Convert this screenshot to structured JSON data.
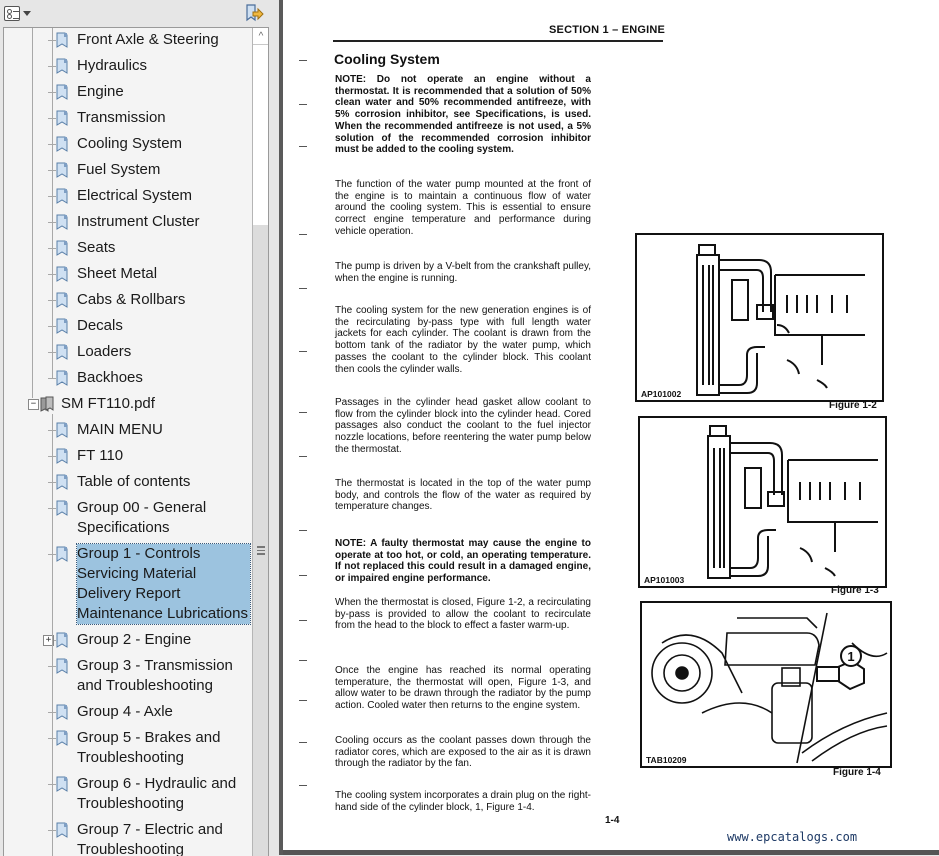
{
  "panel": {
    "toolbar": {
      "options_icon": "bookmark-options-icon",
      "expand_icon": "expand-current-bookmark-icon"
    },
    "bookmarks_top": [
      "Front Axle & Steering",
      "Hydraulics",
      "Engine",
      "Transmission",
      "Cooling System",
      "Fuel System",
      "Electrical System",
      "Instrument Cluster",
      "Seats",
      "Sheet Metal",
      "Cabs & Rollbars",
      "Decals",
      "Loaders",
      "Backhoes"
    ],
    "file_node": {
      "label": "SM FT110.pdf",
      "expander": "−"
    },
    "file_children": [
      {
        "lines": [
          "MAIN MENU"
        ]
      },
      {
        "lines": [
          "FT 110"
        ]
      },
      {
        "lines": [
          "Table of contents"
        ]
      },
      {
        "lines": [
          "Group 00 - General",
          "Specifications"
        ]
      },
      {
        "lines": [
          "Group 1 - Controls",
          "Servicing Material",
          "Delivery Report",
          "Maintenance Lubrications"
        ],
        "selected": true
      },
      {
        "lines": [
          "Group 2 - Engine"
        ],
        "expander": "+"
      },
      {
        "lines": [
          "Group 3 - Transmission",
          "and Troubleshooting"
        ]
      },
      {
        "lines": [
          "Group 4 - Axle"
        ]
      },
      {
        "lines": [
          "Group 5 - Brakes and",
          "Troubleshooting"
        ]
      },
      {
        "lines": [
          "Group 6 - Hydraulic and",
          "Troubleshooting"
        ]
      },
      {
        "lines": [
          "Group 7 - Electric and",
          "Troubleshooting"
        ]
      }
    ],
    "scrollbar": {
      "up_arrow": "^"
    }
  },
  "document": {
    "section_header": "SECTION 1 – ENGINE",
    "title": "Cooling System",
    "paragraphs": [
      {
        "text": "NOTE: Do not operate an engine without a thermostat. It is recommended that a solution of 50% clean water and 50% recommended antifreeze, with 5% corrosion inhibitor, see Specifications, is used. When the recommended antifreeze is not used, a 5% solution of the recommended corrosion inhibitor must be added to the cooling system.",
        "bold": true
      },
      {
        "text": "The function of the water pump mounted at the front of the engine is to maintain a continuous flow of water around the cooling system. This is essential to ensure correct engine temperature and performance during vehicle operation."
      },
      {
        "text": "The pump is driven by a V-belt from the crankshaft pulley, when the engine is running."
      },
      {
        "text": "The cooling system for the new generation engines is of the recirculating by-pass type with full length water jackets for each cylinder. The coolant is drawn from the bottom tank of the radiator by the water pump, which passes the coolant to the cylinder block. This coolant then cools the cylinder walls."
      },
      {
        "text": "Passages in the cylinder head gasket allow coolant to flow from the cylinder block into the cylinder head. Cored passages also conduct the coolant to the fuel injector nozzle locations, before reentering the water pump below the thermostat."
      },
      {
        "text": "The thermostat is located in the top of the water pump body, and controls the flow of the water as required by temperature changes."
      },
      {
        "text": "NOTE: A faulty thermostat may cause the engine to operate at too hot, or cold, an operating temperature. If not replaced this could result in a damaged engine, or impaired engine performance.",
        "bold": true
      },
      {
        "text": "When the thermostat is closed, Figure 1-2, a recirculating by-pass is provided to allow the coolant to recirculate from the head to the block to effect a faster warm-up."
      },
      {
        "text": "Once the engine has reached its normal operating temperature, the thermostat will open, Figure 1-3, and allow water to be drawn through the radiator by the pump action. Cooled water then returns to the engine system."
      },
      {
        "text": "Cooling occurs as the coolant passes down through the radiator cores, which are exposed to the air as it is drawn through the radiator by the fan."
      },
      {
        "text": "The cooling system incorporates a drain plug on the right-hand side of the cylinder block, 1, Figure 1-4."
      }
    ],
    "figures": [
      {
        "id": "AP101002",
        "caption": "Figure 1-2",
        "description": "Radiator and thermostat, thermostat closed"
      },
      {
        "id": "AP101003",
        "caption": "Figure 1-3",
        "description": "Radiator and thermostat, thermostat open"
      },
      {
        "id": "TAB10209",
        "caption": "Figure 1-4",
        "description": "Engine side view with drain plug",
        "callout": "1"
      }
    ],
    "page_number": "1-4",
    "watermark": "www.epcatalogs.com"
  }
}
